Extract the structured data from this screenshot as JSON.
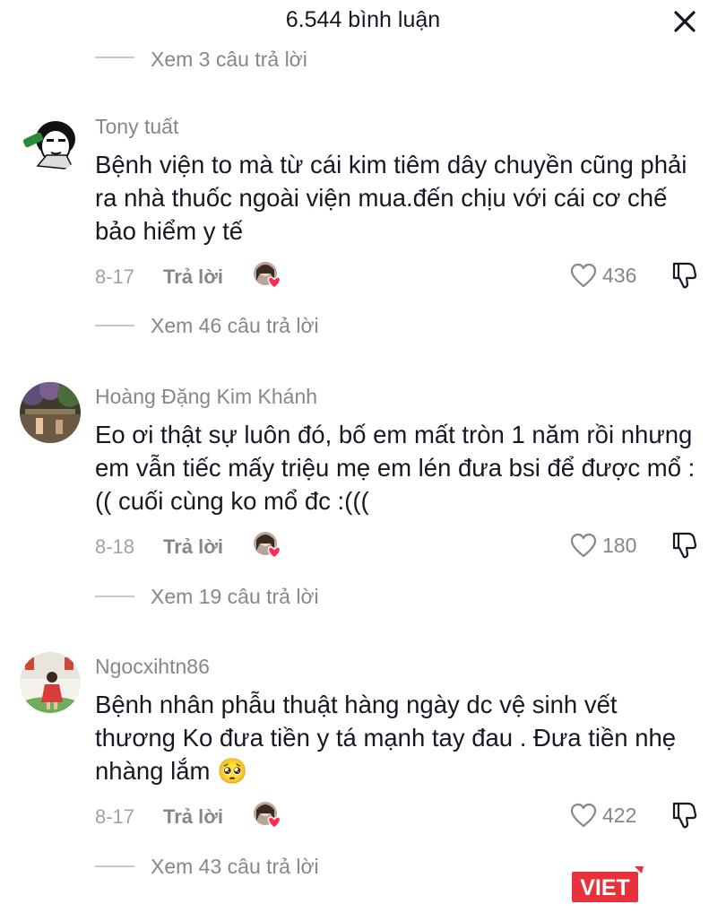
{
  "header": {
    "title": "6.544 bình luận"
  },
  "top_replies_label": "Xem 3 câu trả lời",
  "comments": [
    {
      "username": "Tony tuất",
      "text": "Bệnh viện to mà từ cái kim tiêm dây chuyền cũng phải ra nhà thuốc ngoài viện mua.đến chịu với cái cơ chế bảo hiểm y tế",
      "date": "8-17",
      "reply_label": "Trả lời",
      "likes": "436",
      "view_replies": "Xem 46 câu trả lời"
    },
    {
      "username": "Hoàng Đặng Kim Khánh",
      "text": "Eo ơi thật sự luôn đó, bố em mất tròn 1 năm rồi nhưng em vẫn tiếc mấy triệu mẹ em lén đưa bsi để được mổ :(( cuối cùng ko mổ đc :(((",
      "date": "8-18",
      "reply_label": "Trả lời",
      "likes": "180",
      "view_replies": "Xem 19 câu trả lời"
    },
    {
      "username": "Ngocxihtn86",
      "text": "Bệnh nhân phẫu thuật hàng ngày dc vệ sinh vết thương Ko đưa tiền y tá mạnh tay đau . Đưa tiền nhẹ nhàng lắm 🥺",
      "date": "8-17",
      "reply_label": "Trả lời",
      "likes": "422",
      "view_replies": "Xem 43 câu trả lời"
    }
  ],
  "watermark": {
    "text": "VIET",
    "color": "#e8313a"
  },
  "colors": {
    "text": "#161823",
    "secondary": "#86878b",
    "heart": "#fe2c55"
  }
}
